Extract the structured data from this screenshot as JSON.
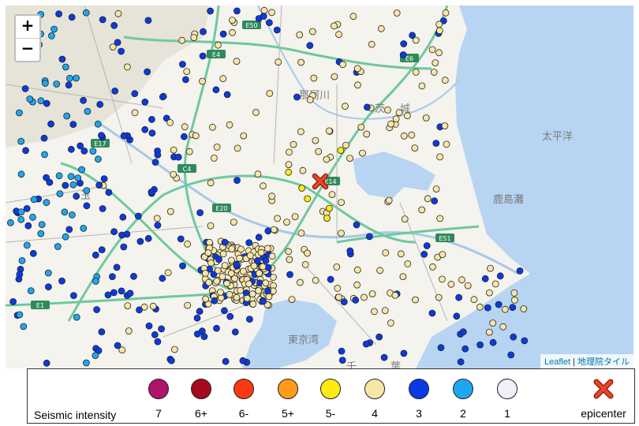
{
  "map": {
    "zoom_in_label": "+",
    "zoom_out_label": "−",
    "attribution_leaflet": "Leaflet",
    "attribution_separator": " | ",
    "attribution_gsi": "地理院タイル",
    "place_labels": [
      "茨",
      "城",
      "玉",
      "那珂川",
      "太平洋",
      "鹿島灘",
      "東京湾",
      "千",
      "葉"
    ],
    "road_labels": [
      "E50",
      "E4",
      "E6",
      "E51",
      "E17",
      "C4",
      "E14",
      "E20",
      "E1"
    ]
  },
  "colors": {
    "sea": "#b7d5f2",
    "land": "#f5f3ee",
    "mountain": "#e3e0d6",
    "expressway": "#6dc99e",
    "road": "#9b9b9b",
    "river": "#a8c9e8",
    "epicenter": "#e8452c"
  },
  "legend": {
    "title": "Seismic intensity",
    "items": [
      {
        "label": "7",
        "color": "#b0136b"
      },
      {
        "label": "6+",
        "color": "#a50a1f"
      },
      {
        "label": "6-",
        "color": "#fb3a12"
      },
      {
        "label": "5+",
        "color": "#ff9a1a"
      },
      {
        "label": "5-",
        "color": "#ffeb0f"
      },
      {
        "label": "4",
        "color": "#f8e6a8"
      },
      {
        "label": "3",
        "color": "#0a3ae6"
      },
      {
        "label": "2",
        "color": "#1ea7f1"
      },
      {
        "label": "1",
        "color": "#f0f0fa"
      }
    ],
    "epicenter_label": "epicenter"
  }
}
